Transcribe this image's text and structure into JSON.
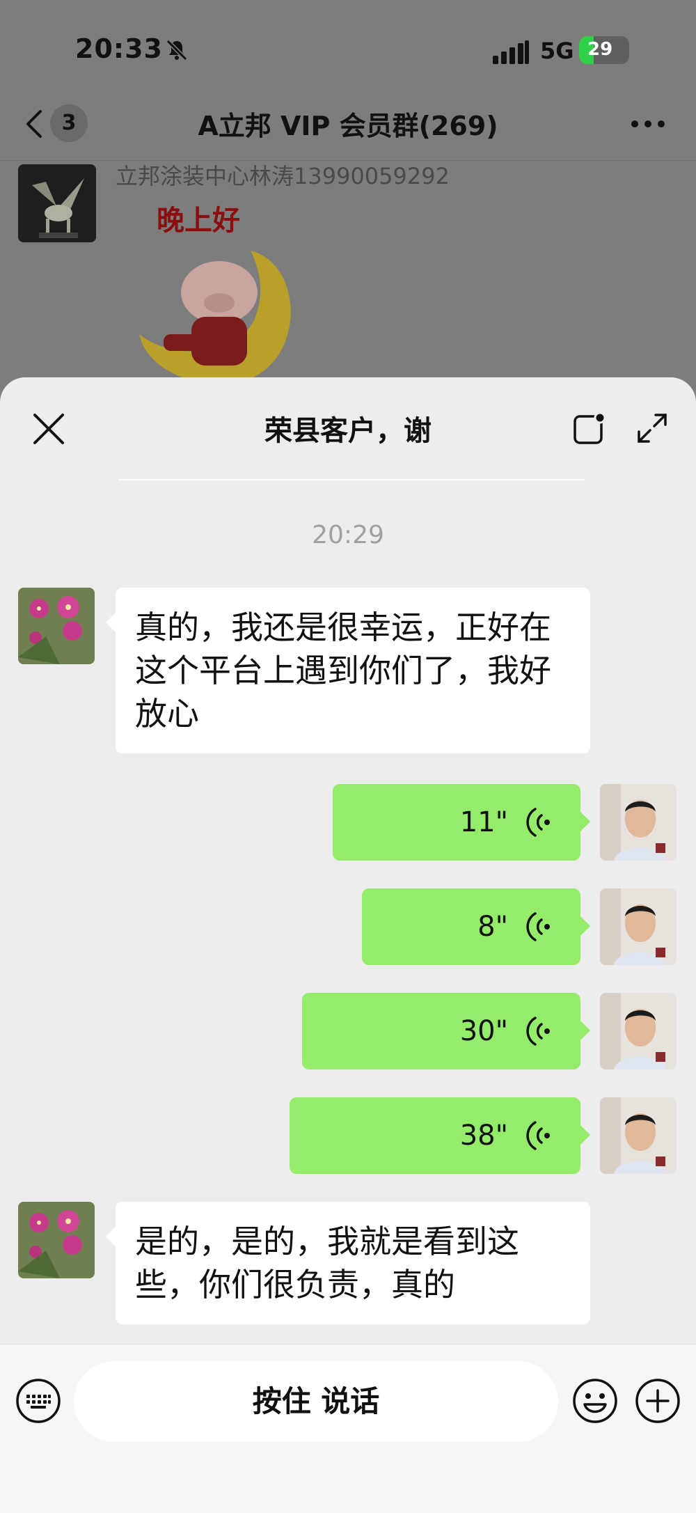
{
  "status_bar": {
    "time": "20:33",
    "network": "5G",
    "battery": "29",
    "battery_level": 0.29
  },
  "nav": {
    "unread_count": "3",
    "group_title": "A立邦 VIP 会员群(269)"
  },
  "background_message": {
    "sender": "立邦涂装中心林涛13990059292",
    "sticker_text": "晚上好"
  },
  "sheet": {
    "title": "荣县客户，谢",
    "timestamp": "20:29",
    "messages": [
      {
        "side": "left",
        "type": "text",
        "text": "真的，我还是很幸运，正好在这个平台上遇到你们了，我好放心"
      },
      {
        "side": "right",
        "type": "voice",
        "duration": "11\""
      },
      {
        "side": "right",
        "type": "voice",
        "duration": "8\""
      },
      {
        "side": "right",
        "type": "voice",
        "duration": "30\""
      },
      {
        "side": "right",
        "type": "voice",
        "duration": "38\""
      },
      {
        "side": "left",
        "type": "text",
        "text": "是的，是的，我就是看到这些，你们很负责，真的"
      }
    ]
  },
  "input_bar": {
    "hold_to_talk": "按住 说话"
  },
  "icons": [
    "bell-slash-icon",
    "signal-icon",
    "battery-icon",
    "back-chevron-icon",
    "more-dots-icon",
    "close-icon",
    "minimize-icon",
    "expand-icon",
    "voice-wave-icon",
    "keyboard-icon",
    "emoji-icon",
    "plus-icon"
  ],
  "colors": {
    "voice_bubble": "#95eb6a",
    "sheet_bg": "#ededed",
    "dim_bg": "#7d7d7d",
    "battery_green": "#2fd14a"
  }
}
